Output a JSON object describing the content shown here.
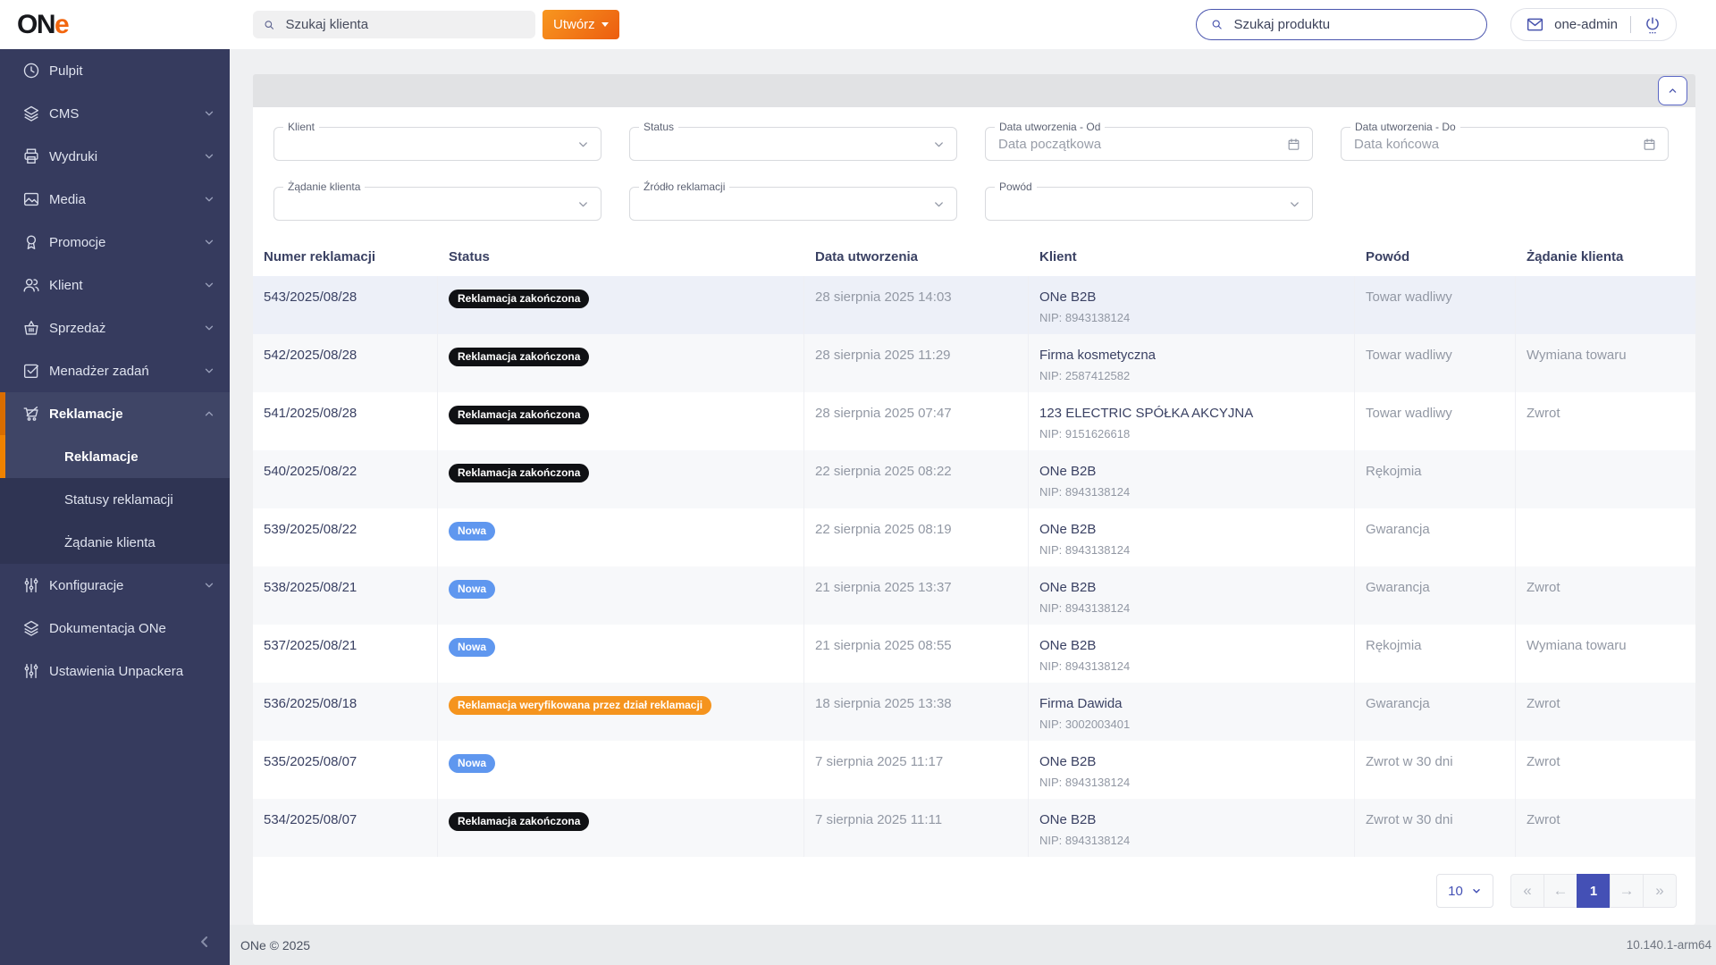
{
  "topbar": {
    "logo_part1": "ON",
    "logo_part2": "e",
    "client_search_placeholder": "Szukaj klienta",
    "create_button_label": "Utwórz",
    "product_search_placeholder": "Szukaj produktu",
    "username": "one-admin"
  },
  "sidebar": {
    "items": [
      {
        "label": "Pulpit"
      },
      {
        "label": "CMS"
      },
      {
        "label": "Wydruki"
      },
      {
        "label": "Media"
      },
      {
        "label": "Promocje"
      },
      {
        "label": "Klient"
      },
      {
        "label": "Sprzedaż"
      },
      {
        "label": "Menadżer zadań"
      },
      {
        "label": "Reklamacje"
      }
    ],
    "submenu": [
      {
        "label": "Reklamacje"
      },
      {
        "label": "Statusy reklamacji"
      },
      {
        "label": "Żądanie klienta"
      }
    ],
    "items_bottom": [
      {
        "label": "Konfiguracje"
      },
      {
        "label": "Dokumentacja ONe"
      },
      {
        "label": "Ustawienia Unpackera"
      }
    ]
  },
  "filters": {
    "fields": [
      {
        "label": "Klient",
        "type": "select"
      },
      {
        "label": "Status",
        "type": "select"
      },
      {
        "label": "Data utworzenia - Od",
        "placeholder": "Data początkowa",
        "type": "date"
      },
      {
        "label": "Data utworzenia - Do",
        "placeholder": "Data końcowa",
        "type": "date"
      },
      {
        "label": "Żądanie klienta",
        "type": "select"
      },
      {
        "label": "Źródło reklamacji",
        "type": "select"
      },
      {
        "label": "Powód",
        "type": "select"
      }
    ]
  },
  "table": {
    "columns": [
      "Numer reklamacji",
      "Status",
      "Data utworzenia",
      "Klient",
      "Powód",
      "Żądanie klienta"
    ],
    "rows": [
      {
        "number": "543/2025/08/28",
        "status_label": "Reklamacja zakończona",
        "status_class": "badge-done",
        "created": "28 sierpnia 2025 14:03",
        "client": "ONe B2B",
        "nip": "NIP: 8943138124",
        "reason": "Towar wadliwy",
        "request": ""
      },
      {
        "number": "542/2025/08/28",
        "status_label": "Reklamacja zakończona",
        "status_class": "badge-done",
        "created": "28 sierpnia 2025 11:29",
        "client": "Firma kosmetyczna",
        "nip": "NIP: 2587412582",
        "reason": "Towar wadliwy",
        "request": "Wymiana towaru"
      },
      {
        "number": "541/2025/08/28",
        "status_label": "Reklamacja zakończona",
        "status_class": "badge-done",
        "created": "28 sierpnia 2025 07:47",
        "client": "123 ELECTRIC SPÓŁKA AKCYJNA",
        "nip": "NIP: 9151626618",
        "reason": "Towar wadliwy",
        "request": "Zwrot"
      },
      {
        "number": "540/2025/08/22",
        "status_label": "Reklamacja zakończona",
        "status_class": "badge-done",
        "created": "22 sierpnia 2025 08:22",
        "client": "ONe B2B",
        "nip": "NIP: 8943138124",
        "reason": "Rękojmia",
        "request": ""
      },
      {
        "number": "539/2025/08/22",
        "status_label": "Nowa",
        "status_class": "badge-new",
        "created": "22 sierpnia 2025 08:19",
        "client": "ONe B2B",
        "nip": "NIP: 8943138124",
        "reason": "Gwarancja",
        "request": ""
      },
      {
        "number": "538/2025/08/21",
        "status_label": "Nowa",
        "status_class": "badge-new",
        "created": "21 sierpnia 2025 13:37",
        "client": "ONe B2B",
        "nip": "NIP: 8943138124",
        "reason": "Gwarancja",
        "request": "Zwrot"
      },
      {
        "number": "537/2025/08/21",
        "status_label": "Nowa",
        "status_class": "badge-new",
        "created": "21 sierpnia 2025 08:55",
        "client": "ONe B2B",
        "nip": "NIP: 8943138124",
        "reason": "Rękojmia",
        "request": "Wymiana towaru"
      },
      {
        "number": "536/2025/08/18",
        "status_label": "Reklamacja weryfikowana przez dział reklamacji",
        "status_class": "badge-verify",
        "created": "18 sierpnia 2025 13:38",
        "client": "Firma Dawida",
        "nip": "NIP: 3002003401",
        "reason": "Gwarancja",
        "request": "Zwrot"
      },
      {
        "number": "535/2025/08/07",
        "status_label": "Nowa",
        "status_class": "badge-new",
        "created": "7 sierpnia 2025 11:17",
        "client": "ONe B2B",
        "nip": "NIP: 8943138124",
        "reason": "Zwrot w 30 dni",
        "request": "Zwrot"
      },
      {
        "number": "534/2025/08/07",
        "status_label": "Reklamacja zakończona",
        "status_class": "badge-done",
        "created": "7 sierpnia 2025 11:11",
        "client": "ONe B2B",
        "nip": "NIP: 8943138124",
        "reason": "Zwrot w 30 dni",
        "request": "Zwrot"
      }
    ]
  },
  "pagination": {
    "page_size": "10",
    "first": "«",
    "prev": "←",
    "current_page": "1",
    "next": "→",
    "last": "»"
  },
  "footer": {
    "copyright": "ONe © 2025",
    "version": "10.140.1-arm64"
  },
  "theme": {
    "sidebar_bg": "#363B5E",
    "sidebar_active_bg": "#3F4566",
    "accent_orange_bar": "#EF8200",
    "create_button_gradient": [
      "#F8971F",
      "#EC5D10"
    ],
    "primary_indigo": "#4450B5",
    "badge_done_color": "#101114",
    "badge_new_color": "#5F97EF",
    "badge_verify_color": "#F5941E",
    "logo_e_color": "#F2660E"
  }
}
